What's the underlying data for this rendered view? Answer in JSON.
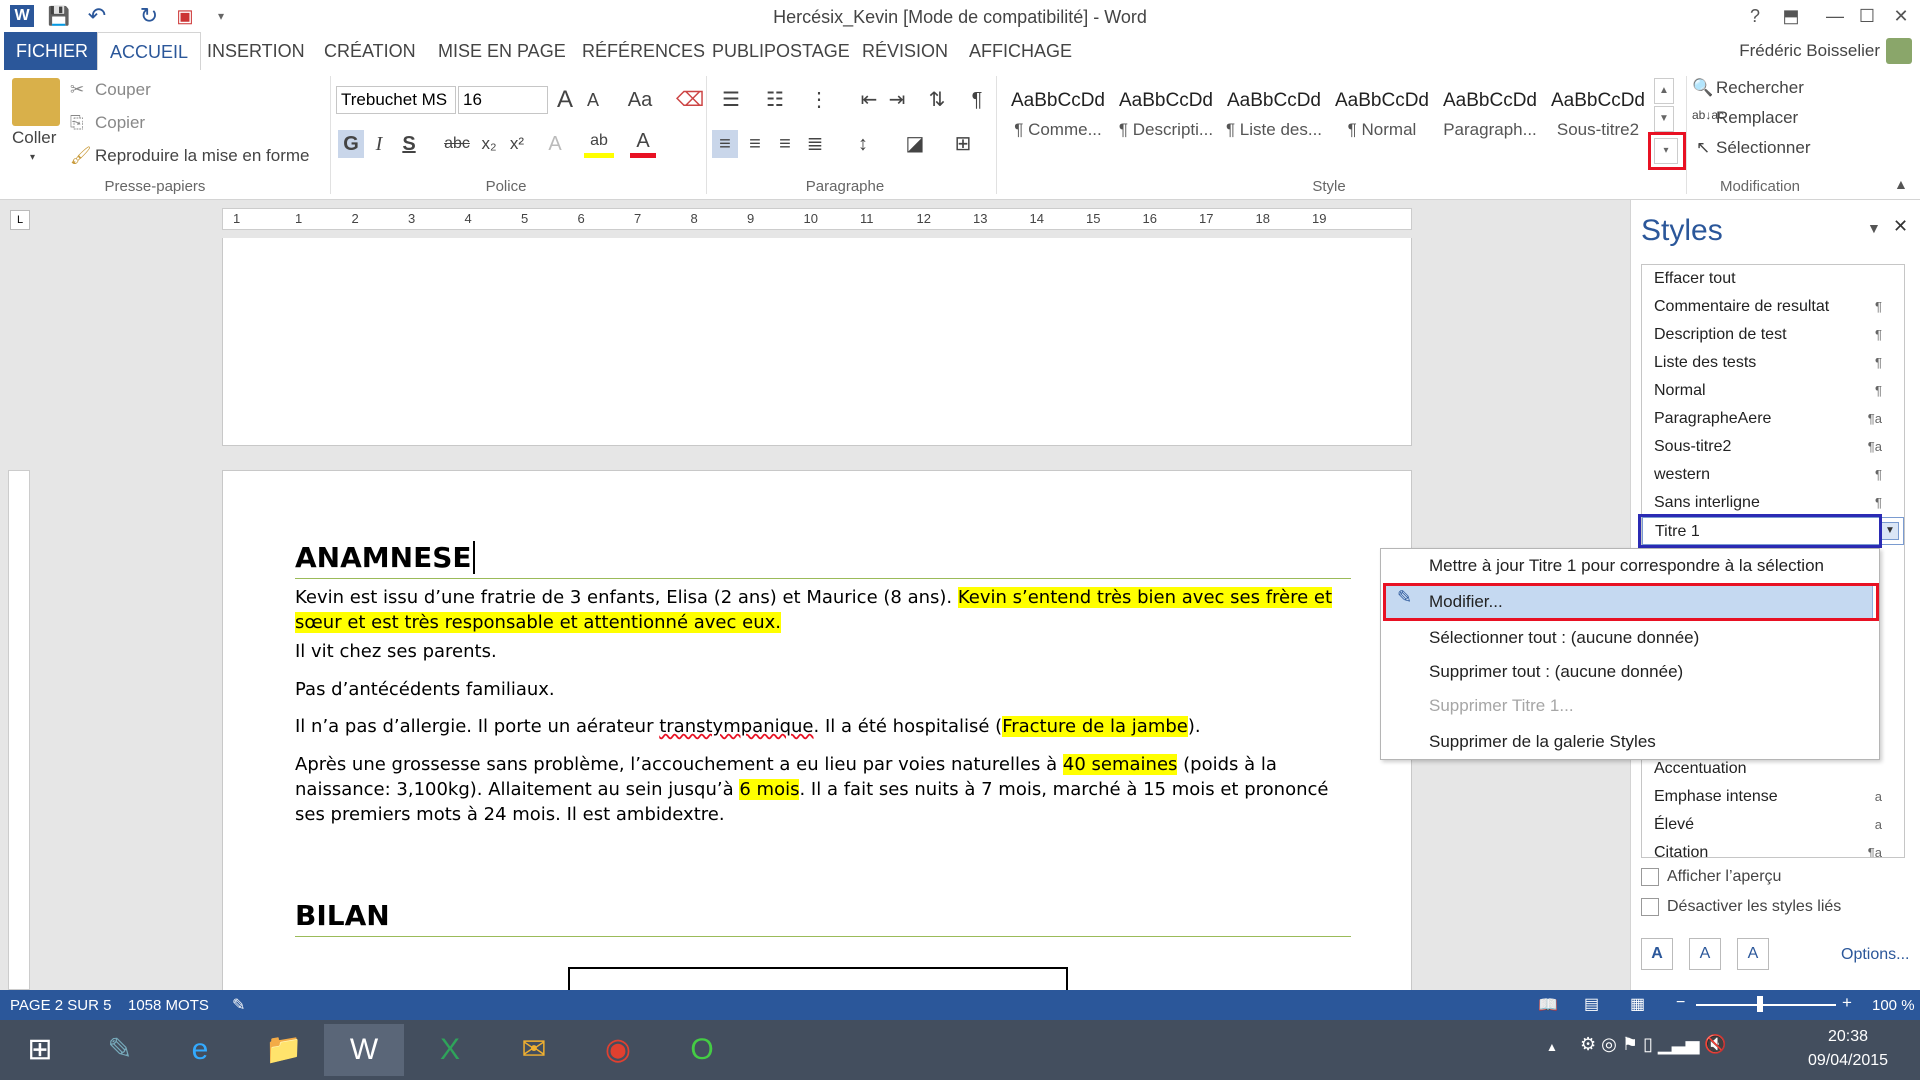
{
  "window": {
    "title": "Hercésix_Kevin [Mode de compatibilité] - Word",
    "help": "?",
    "restore": "⬒",
    "minimize": "—",
    "maximize": "☐",
    "close": "✕"
  },
  "qat": {
    "word_icon": "W",
    "save_icon": "💾",
    "undo_icon": "↶",
    "redo_icon": "↻",
    "custom_icon": "▾"
  },
  "tabs": [
    "FICHIER",
    "ACCUEIL",
    "INSERTION",
    "CRÉATION",
    "MISE EN PAGE",
    "RÉFÉRENCES",
    "PUBLIPOSTAGE",
    "RÉVISION",
    "AFFICHAGE"
  ],
  "user": "Frédéric Boisselier",
  "clipboard": {
    "paste": "Coller",
    "cut": "Couper",
    "copy": "Copier",
    "format_painter": "Reproduire la mise en forme",
    "group": "Presse-papiers"
  },
  "font": {
    "name": "Trebuchet MS",
    "size": "16",
    "group": "Police",
    "bold": "G",
    "italic": "I",
    "underline": "S",
    "strike": "abc",
    "sub": "x₂",
    "sup": "x²",
    "grow": "A",
    "shrink": "A",
    "case": "Aa",
    "clear": "⌫"
  },
  "paragraph": {
    "group": "Paragraphe",
    "pilcrow": "¶"
  },
  "styles_gallery": {
    "group": "Style",
    "items": [
      {
        "sample": "AaBbCcDd",
        "name": "¶ Comme..."
      },
      {
        "sample": "AaBbCcDd",
        "name": "¶ Descripti..."
      },
      {
        "sample": "AaBbCcDd",
        "name": "¶ Liste des..."
      },
      {
        "sample": "AaBbCcDd",
        "name": "¶ Normal"
      },
      {
        "sample": "AaBbCcDd",
        "name": "Paragraph..."
      },
      {
        "sample": "AaBbCcDd",
        "name": "Sous-titre2"
      }
    ]
  },
  "editing": {
    "find": "Rechercher",
    "replace": "Remplacer",
    "select": "Sélectionner",
    "group": "Modification"
  },
  "ruler": {
    "numbers": [
      "1",
      "1",
      "2",
      "3",
      "4",
      "5",
      "6",
      "7",
      "8",
      "9",
      "10",
      "11",
      "12",
      "13",
      "14",
      "15",
      "16",
      "17",
      "18",
      "19"
    ]
  },
  "document": {
    "heading1": "ANAMNESE",
    "p1a": "Kevin est issu d’une fratrie de 3 enfants, Elisa (2 ans) et Maurice (8 ans). ",
    "p1b": "Kevin s’entend très bien avec ses frère et sœur et est très responsable et attentionné avec eux.",
    "p2": "Il vit chez ses parents.",
    "p3": "Pas d’antécédents familiaux.",
    "p4a": "Il n’a pas d’allergie. Il porte un aérateur ",
    "p4b": "transtympanique",
    "p4c": ". Il a été hospitalisé (",
    "p4d": "Fracture de la jambe",
    "p4e": ").",
    "p5a": "Après une grossesse sans problème, l’accouchement a eu lieu par voies naturelles à ",
    "p5b": "40 semaines",
    "p5c": " (poids à la naissance: 3,100kg). Allaitement au sein jusqu’à ",
    "p5d": "6 mois",
    "p5e": ". Il a fait ses nuits à 7 mois, marché à 15 mois et prononcé ses premiers mots à 24 mois. Il est ambidextre.",
    "heading2": "BILAN"
  },
  "styles_pane": {
    "title": "Styles",
    "items": [
      {
        "name": "Effacer tout",
        "mark": ""
      },
      {
        "name": "Commentaire de resultat",
        "mark": "¶"
      },
      {
        "name": "Description de test",
        "mark": "¶"
      },
      {
        "name": "Liste des tests",
        "mark": "¶"
      },
      {
        "name": "Normal",
        "mark": "¶"
      },
      {
        "name": "ParagrapheAere",
        "mark": "¶a"
      },
      {
        "name": "Sous-titre2",
        "mark": "¶a"
      },
      {
        "name": "western",
        "mark": "¶"
      },
      {
        "name": "Sans interligne",
        "mark": "¶"
      },
      {
        "name": "Titre 1",
        "mark": ""
      }
    ],
    "items_below": [
      {
        "name": "Accentuation",
        "mark": ""
      },
      {
        "name": "Emphase intense",
        "mark": "a"
      },
      {
        "name": "Élevé",
        "mark": "a"
      },
      {
        "name": "Citation",
        "mark": "¶a"
      }
    ],
    "show_preview": "Afficher l’aperçu",
    "disable_linked": "Désactiver les styles liés",
    "options": "Options..."
  },
  "context_menu": [
    {
      "label": "Mettre à jour Titre 1 pour correspondre à la sélection",
      "enabled": true
    },
    {
      "label": "Modifier...",
      "enabled": true
    },
    {
      "label": "Sélectionner tout : (aucune donnée)",
      "enabled": true
    },
    {
      "label": "Supprimer tout : (aucune donnée)",
      "enabled": true
    },
    {
      "label": "Supprimer Titre 1...",
      "enabled": false
    },
    {
      "label": "Supprimer de la galerie Styles",
      "enabled": true
    }
  ],
  "status": {
    "page": "PAGE 2 SUR 5",
    "words": "1058 MOTS",
    "zoom": "100 %"
  },
  "taskbar": {
    "time": "20:38",
    "date": "09/04/2015"
  },
  "colors": {
    "accent": "#2b579a",
    "highlight": "#ffff00",
    "heading_rule": "#9bbb59",
    "annotation_red": "#e81123",
    "annotation_blue": "#2b2bb4"
  }
}
